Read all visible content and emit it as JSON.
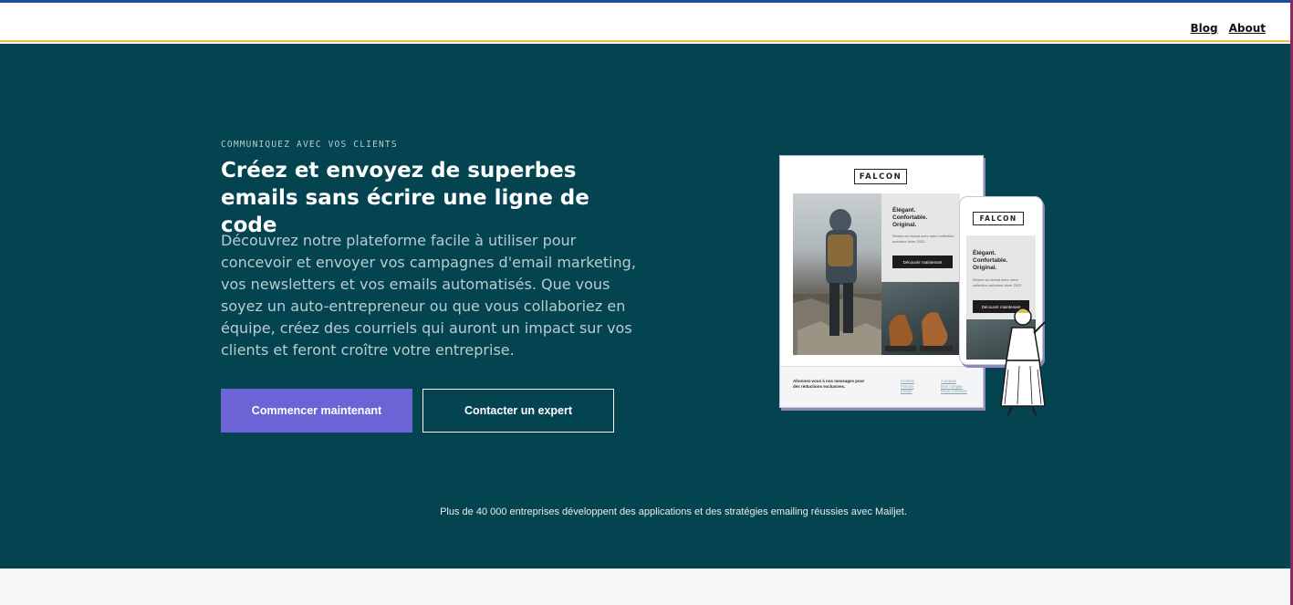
{
  "nav": {
    "blog": "Blog",
    "about": "About"
  },
  "hero": {
    "eyebrow": "COMMUNIQUEZ AVEC VOS CLIENTS",
    "headline": "Créez et envoyez de superbes emails sans écrire une ligne de code",
    "description": "Découvrez notre plateforme facile à utiliser pour concevoir et envoyer vos campagnes d'email marketing, vos newsletters et vos emails automatisés. Que vous soyez un auto-entrepreneur ou que vous collaboriez en équipe, créez des courriels qui auront un impact sur vos clients et feront croître votre entreprise.",
    "primary_button": "Commencer maintenant",
    "secondary_button": "Contacter un expert",
    "trust_line": "Plus de 40 000 entreprises développent des applications et des stratégies emailing réussies avec Mailjet."
  },
  "illustration": {
    "brand": "FALCON",
    "panel_title": "Élégant. Confortable. Original.",
    "panel_text": "Restez au chaud avec notre collection automne-hiver 2022",
    "panel_button": "Découvrir maintenant",
    "phone_text": "Restez au chaud avec notre collection automne-hiver 2022",
    "footer_text": "Abonnez-vous à nos messages pour des réductions exclusives.",
    "footer_links_a": [
      "Homme",
      "Femme",
      "Enfant"
    ],
    "footer_links_b": [
      "À propos",
      "Mon compte",
      "Nous contacter"
    ]
  },
  "colors": {
    "hero_bg": "#034450",
    "primary_button": "#6b63d6",
    "top_border": "#1b4f9c"
  }
}
